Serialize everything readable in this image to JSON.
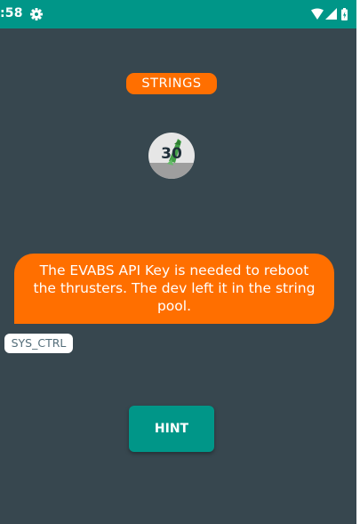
{
  "status_bar": {
    "time": ":58",
    "icons": [
      "settings-icon",
      "wifi-icon",
      "signal-icon",
      "battery-icon"
    ]
  },
  "screen": {
    "title": "STRINGS",
    "level_number": "30",
    "message": "The EVABS API Key is needed to reboot the thrusters. The dev left it in the string pool.",
    "tag": "SYS_CTRL",
    "hint_label": "HINT"
  },
  "colors": {
    "status_bar": "#009688",
    "background": "#37474f",
    "accent_orange": "#ff6f00",
    "button_teal": "#009688"
  }
}
